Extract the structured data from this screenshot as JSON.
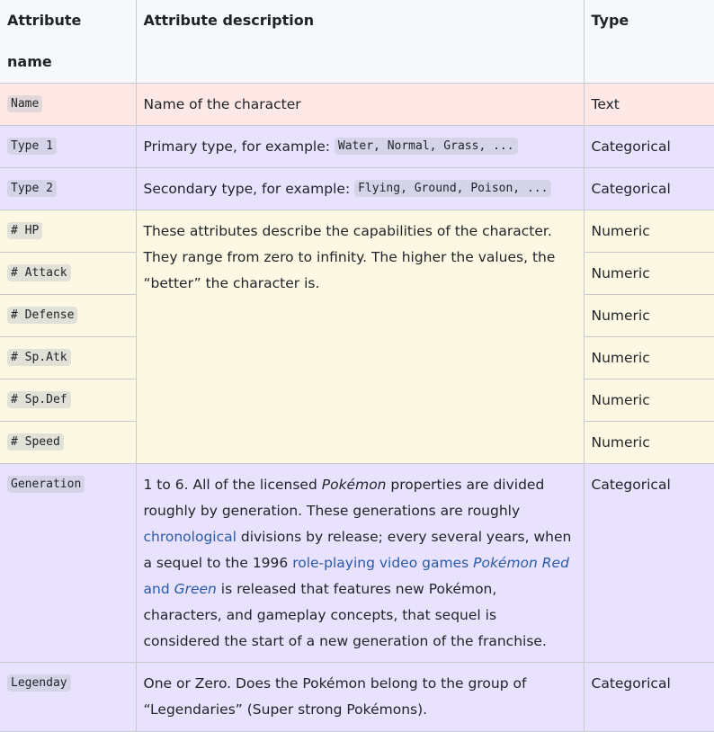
{
  "header": {
    "col1": "Attribute name",
    "col2": "Attribute description",
    "col3": "Type"
  },
  "rows": {
    "name": {
      "attr": "Name",
      "desc": "Name of the character",
      "type": "Text"
    },
    "type1": {
      "attr": "Type 1",
      "desc_prefix": "Primary type, for example: ",
      "desc_code": "Water, Normal, Grass, ...",
      "type": "Categorical"
    },
    "type2": {
      "attr": "Type 2",
      "desc_prefix": "Secondary type, for example: ",
      "desc_code": "Flying, Ground, Poison, ...",
      "type": "Categorical"
    },
    "stats": {
      "desc": "These attributes describe the capabilities of the character. They range from zero to infinity. The higher the values, the “better” the character is.",
      "items": [
        {
          "attr": "# HP",
          "type": "Numeric"
        },
        {
          "attr": "# Attack",
          "type": "Numeric"
        },
        {
          "attr": "# Defense",
          "type": "Numeric"
        },
        {
          "attr": "# Sp.Atk",
          "type": "Numeric"
        },
        {
          "attr": "# Sp.Def",
          "type": "Numeric"
        },
        {
          "attr": "# Speed",
          "type": "Numeric"
        }
      ]
    },
    "generation": {
      "attr": "Generation",
      "t1": "1 to 6. All of the licensed ",
      "t2": "Pokémon",
      "t3": " properties are divided roughly by generation. These generations are roughly ",
      "link1": "chronological",
      "t4": " divisions by release; every several years, when a sequel to the 1996 ",
      "link2a": "role-playing video games ",
      "link2b": "Pokémon Red",
      "link2c": " and ",
      "link2d": "Green",
      "t5": " is released that features new Pokémon, characters, and gameplay concepts, that sequel is considered the start of a new generation of the franchise.",
      "type": "Categorical"
    },
    "legendary": {
      "attr": "Legenday",
      "desc": "One or Zero. Does the Pokémon belong to the group of “Legendaries” (Super strong Pokémons).",
      "type": "Categorical"
    }
  }
}
